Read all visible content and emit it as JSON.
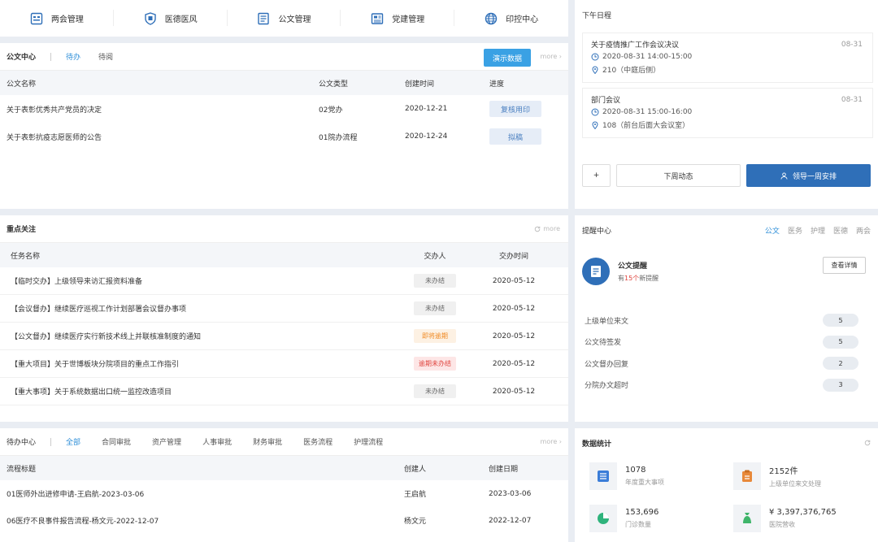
{
  "nav": {
    "items": [
      {
        "label": "两会管理",
        "icon": "calendar-grid-icon"
      },
      {
        "label": "医德医风",
        "icon": "shield-badge-icon"
      },
      {
        "label": "公文管理",
        "icon": "document-icon"
      },
      {
        "label": "党建管理",
        "icon": "newspaper-icon"
      },
      {
        "label": "印控中心",
        "icon": "globe-icon"
      }
    ]
  },
  "doc": {
    "title": "公文中心",
    "tabs": [
      "待办",
      "待阅"
    ],
    "demo_button": "演示数据",
    "more": "more ›",
    "columns": [
      "公文名称",
      "公文类型",
      "创建时间",
      "进度"
    ],
    "rows": [
      {
        "name": "关于表彰优秀共产党员的决定",
        "type": "02党办",
        "date": "2020-12-21",
        "progress": "复核用印"
      },
      {
        "name": "关于表彰抗疫志愿医师的公告",
        "type": "01院办流程",
        "date": "2020-12-24",
        "progress": "拟稿"
      }
    ]
  },
  "schedule": {
    "title": "下午日程",
    "events": [
      {
        "title": "关于疫情推广工作会议决议",
        "date": "08-31",
        "time": "2020-08-31 14:00-15:00",
        "place": "210（中庭后侧）"
      },
      {
        "title": "部门会议",
        "date": "08-31",
        "time": "2020-08-31 15:00-16:00",
        "place": "108（前台后面大会议室）"
      }
    ],
    "add_label": "+",
    "next_label": "下周动态",
    "leader_label": "领导一周安排"
  },
  "focus": {
    "title": "重点关注",
    "more": "more",
    "columns": [
      "任务名称",
      "交办人",
      "交办时间"
    ],
    "rows": [
      {
        "name": "【临时交办】上级领导来访汇报资料准备",
        "status": "未办结",
        "kind": "normal",
        "date": "2020-05-12"
      },
      {
        "name": "【会议督办】继续医疗巡视工作计划部署会议督办事项",
        "status": "未办结",
        "kind": "normal",
        "date": "2020-05-12"
      },
      {
        "name": "【公文督办】继续医疗实行新技术线上并联核准制度的通知",
        "status": "即将逾期",
        "kind": "warn",
        "date": "2020-05-12"
      },
      {
        "name": "【重大项目】关于世博板块分院项目的重点工作指引",
        "status": "逾期未办结",
        "kind": "danger",
        "date": "2020-05-12"
      },
      {
        "name": "【重大事项】关于系统数据出口统一监控改造项目",
        "status": "未办结",
        "kind": "normal",
        "date": "2020-05-12"
      }
    ]
  },
  "remind": {
    "title": "提醒中心",
    "tabs": [
      "公文",
      "医务",
      "护理",
      "医德",
      "两会"
    ],
    "card_title": "公文提醒",
    "card_prefix": "有",
    "card_count": "15个",
    "card_suffix": "新提醒",
    "detail_button": "查看详情",
    "items": [
      {
        "label": "上级单位来文",
        "count": "5"
      },
      {
        "label": "公文待签发",
        "count": "5"
      },
      {
        "label": "公文督办回复",
        "count": "2"
      },
      {
        "label": "分院办文超时",
        "count": "3"
      }
    ]
  },
  "todo": {
    "title": "待办中心",
    "tabs": [
      "全部",
      "合同审批",
      "资产管理",
      "人事审批",
      "财务审批",
      "医务流程",
      "护理流程"
    ],
    "more": "more ›",
    "columns": [
      "流程标题",
      "创建人",
      "创建日期"
    ],
    "rows": [
      {
        "title": "01医师外出进修申请-王启航-2023-03-06",
        "creator": "王启航",
        "date": "2023-03-06"
      },
      {
        "title": "06医疗不良事件报告流程-杨文元-2022-12-07",
        "creator": "杨文元",
        "date": "2022-12-07"
      }
    ]
  },
  "stats": {
    "title": "数据统计",
    "items": [
      {
        "value": "1078",
        "label": "年度重大事项",
        "icon": "list-icon",
        "color": "#3b7dd8"
      },
      {
        "value": "2152件",
        "label": "上级单位来文处理",
        "icon": "clipboard-icon",
        "color": "#e8893a"
      },
      {
        "value": "153,696",
        "label": "门诊数量",
        "icon": "pie-chart-icon",
        "color": "#2fb37c"
      },
      {
        "value": "¥ 3,397,376,765",
        "label": "医院营收",
        "icon": "money-bag-icon",
        "color": "#3fb56a"
      }
    ]
  },
  "colors": {
    "accent": "#2f6fb8",
    "demo": "#3aa1e4",
    "warn": "#f08a24",
    "danger": "#e0443e"
  }
}
